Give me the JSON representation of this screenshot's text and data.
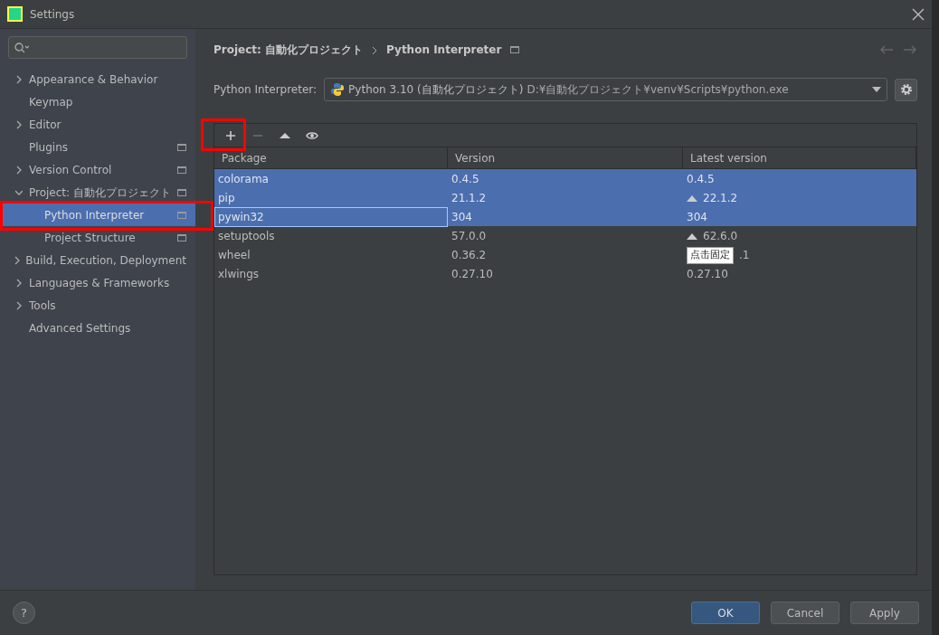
{
  "window": {
    "title": "Settings"
  },
  "sidebar": {
    "items": [
      {
        "label": "Appearance & Behavior",
        "expanded": false,
        "scoped": false,
        "selected": false
      },
      {
        "label": "Keymap",
        "scoped": false,
        "selected": false
      },
      {
        "label": "Editor",
        "expanded": false,
        "scoped": false,
        "selected": false
      },
      {
        "label": "Plugins",
        "scoped": true,
        "selected": false
      },
      {
        "label": "Version Control",
        "expanded": false,
        "scoped": true,
        "selected": false
      },
      {
        "label": "Project: 自動化プロジェクト",
        "expanded": true,
        "scoped": true,
        "selected": false,
        "children": [
          {
            "label": "Python Interpreter",
            "scoped": true,
            "selected": true
          },
          {
            "label": "Project Structure",
            "scoped": true,
            "selected": false
          }
        ]
      },
      {
        "label": "Build, Execution, Deployment",
        "expanded": false,
        "scoped": false,
        "selected": false
      },
      {
        "label": "Languages & Frameworks",
        "expanded": false,
        "scoped": false,
        "selected": false
      },
      {
        "label": "Tools",
        "expanded": false,
        "scoped": false,
        "selected": false
      },
      {
        "label": "Advanced Settings",
        "scoped": false,
        "selected": false
      }
    ]
  },
  "breadcrumb": [
    "Project: 自動化プロジェクト",
    "Python Interpreter"
  ],
  "interpreter": {
    "label": "Python Interpreter:",
    "name": "Python 3.10 (自動化プロジェクト)",
    "path": "D:¥自動化プロジェクト¥venv¥Scripts¥python.exe"
  },
  "toolbar": [
    {
      "kind": "add",
      "disabled": false
    },
    {
      "kind": "remove",
      "disabled": true
    },
    {
      "kind": "upgrade",
      "disabled": false
    },
    {
      "kind": "show",
      "disabled": false
    }
  ],
  "table": {
    "columns": [
      "Package",
      "Version",
      "Latest version"
    ],
    "rows": [
      {
        "package": "colorama",
        "version": "0.4.5",
        "latest": "0.4.5",
        "upgrade": false,
        "selected": true,
        "focused": false
      },
      {
        "package": "pip",
        "version": "21.1.2",
        "latest": "22.1.2",
        "upgrade": true,
        "selected": true,
        "focused": false
      },
      {
        "package": "pywin32",
        "version": "304",
        "latest": "304",
        "upgrade": false,
        "selected": true,
        "focused": true
      },
      {
        "package": "setuptools",
        "version": "57.0.0",
        "latest": "62.6.0",
        "upgrade": true,
        "selected": false,
        "focused": false
      },
      {
        "package": "wheel",
        "version": "0.36.2",
        "latest": ".1",
        "upgrade": false,
        "selected": false,
        "focused": false,
        "tooltip": "点击固定"
      },
      {
        "package": "xlwings",
        "version": "0.27.10",
        "latest": "0.27.10",
        "upgrade": false,
        "selected": false,
        "focused": false
      }
    ]
  },
  "help": "?",
  "buttons": [
    {
      "label": "OK",
      "primary": true
    },
    {
      "label": "Cancel",
      "primary": false
    },
    {
      "label": "Apply",
      "primary": false
    }
  ]
}
